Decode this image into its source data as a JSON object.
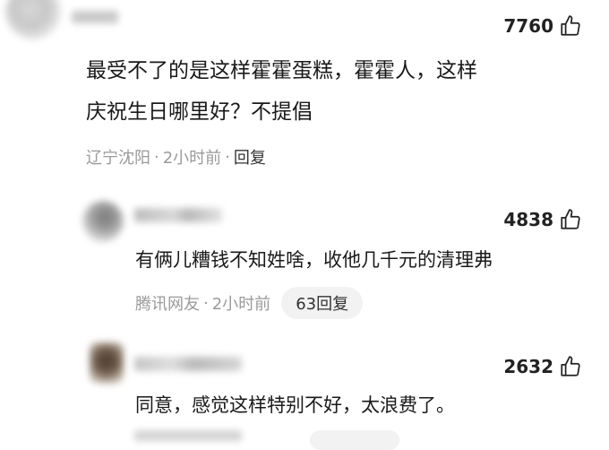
{
  "comment": {
    "likes": "7760",
    "text_lines": [
      "最受不了的是这样霍霍蛋糕，霍霍人，这样",
      "庆祝生日哪里好？不提倡"
    ],
    "location": "辽宁沈阳",
    "time": "2小时前",
    "separator": "·",
    "reply_label": "回复"
  },
  "replies": [
    {
      "likes": "4838",
      "text": "有俩儿糟钱不知姓啥，收他几千元的清理弗",
      "location": "腾讯网友",
      "time": "2小时前",
      "separator": "·",
      "reply_count_label": "63回复"
    },
    {
      "likes": "2632",
      "text": "同意，感觉这样特别不好，太浪费了。"
    }
  ],
  "icons": {
    "like": "thumbs-up-icon"
  }
}
